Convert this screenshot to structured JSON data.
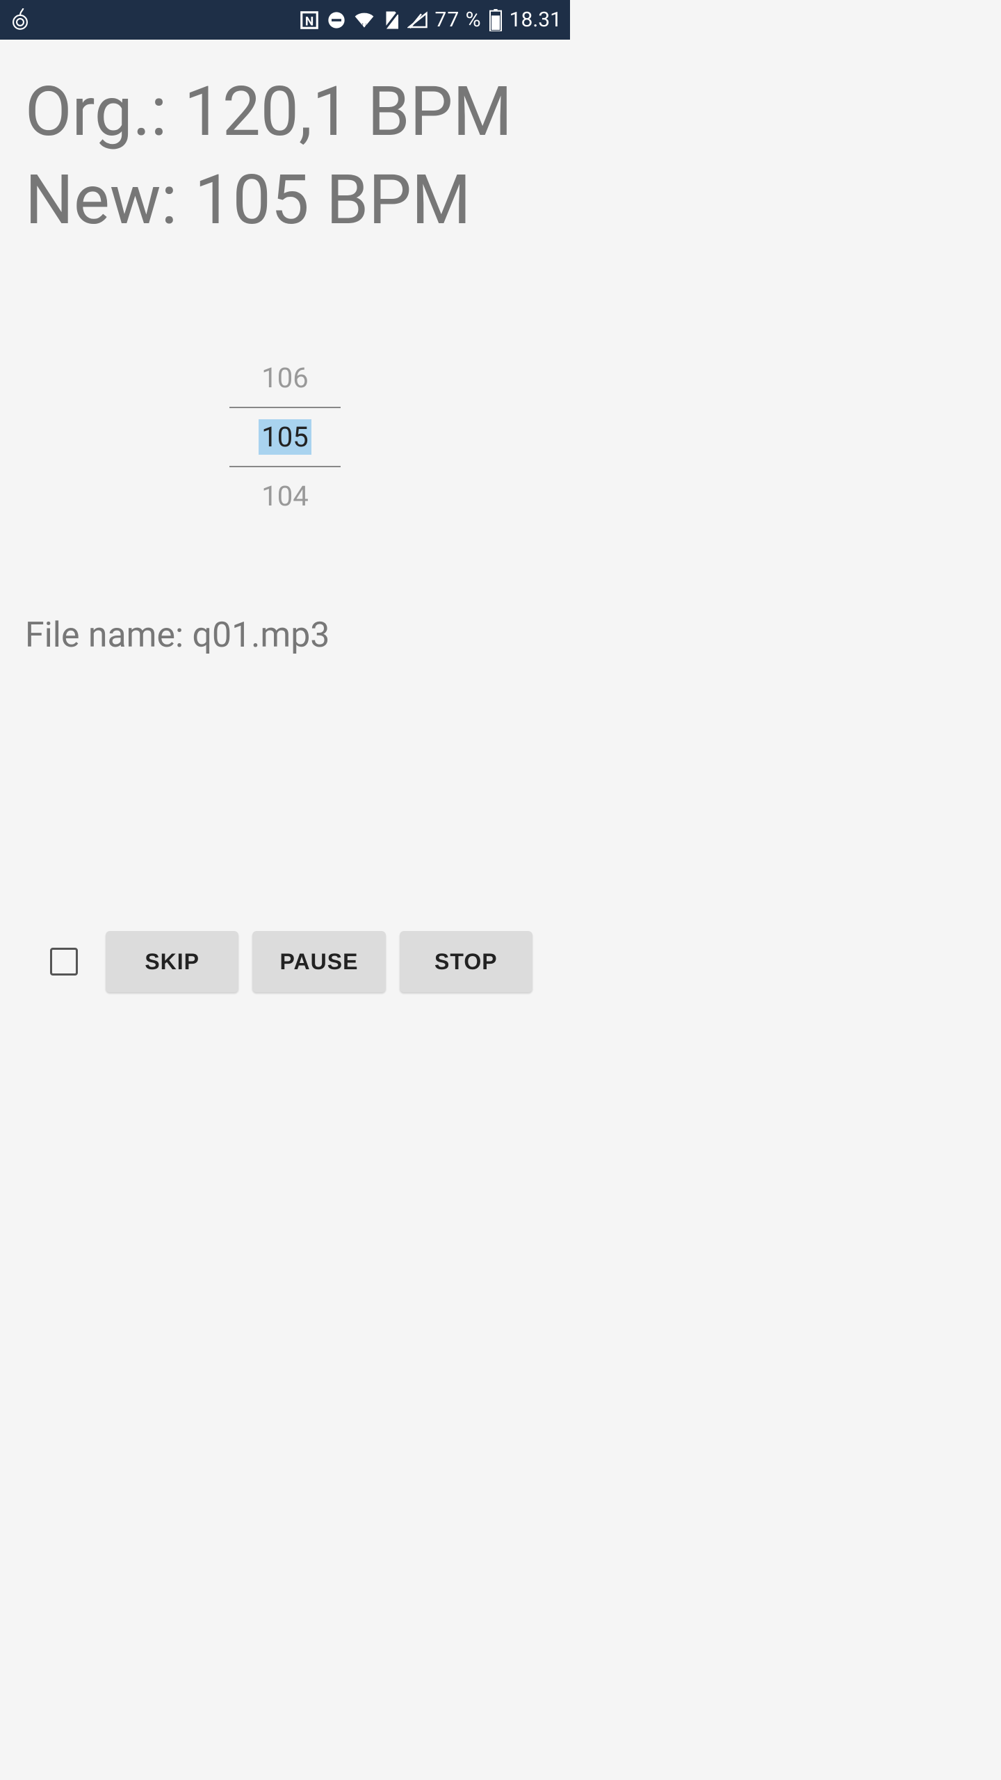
{
  "status": {
    "battery": "77 %",
    "time": "18.31",
    "nfc_label": "N"
  },
  "bpm": {
    "org_line": "Org.: 120,1 BPM",
    "new_line": "New:  105  BPM"
  },
  "picker": {
    "above": "106",
    "selected": "105",
    "below": "104"
  },
  "file": {
    "label_line": "File name: q01.mp3"
  },
  "buttons": {
    "skip": "SKIP",
    "pause": "PAUSE",
    "stop": "STOP"
  }
}
